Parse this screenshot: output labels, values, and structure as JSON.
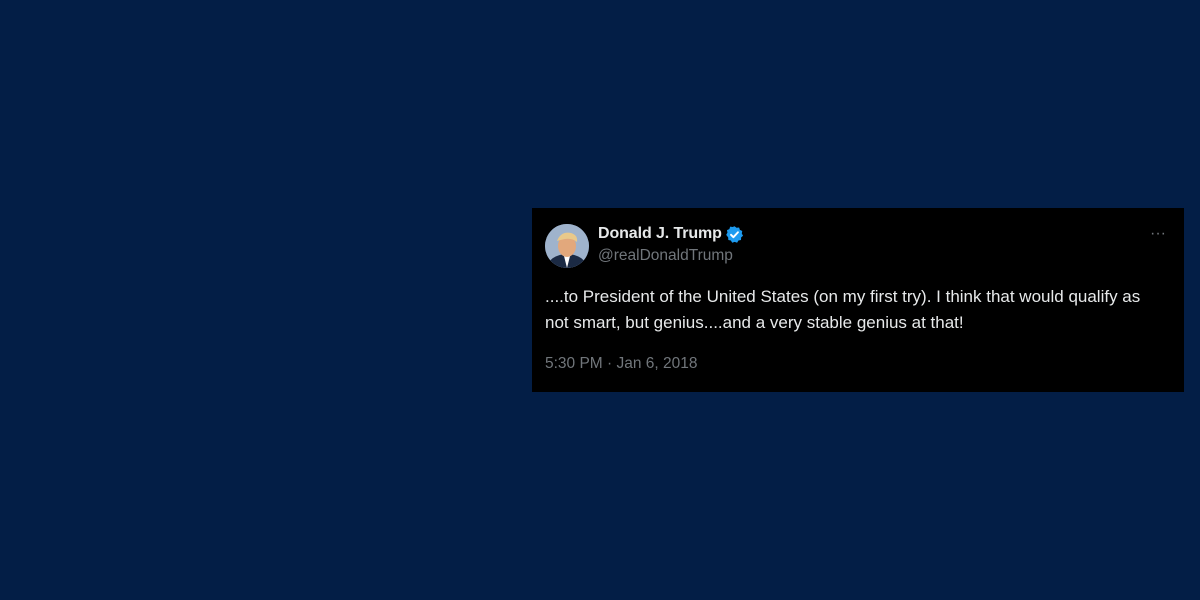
{
  "tweet": {
    "display_name": "Donald J. Trump",
    "handle": "@realDonaldTrump",
    "verified": true,
    "more_label": "···",
    "text": "....to President of the United States (on my first try). I think that would qualify as not smart, but genius....and a very stable genius at that!",
    "timestamp": "5:30 PM · Jan 6, 2018"
  },
  "colors": {
    "page_background": "#031e46",
    "card_background": "#000000",
    "primary_text": "#e7e9ea",
    "secondary_text": "#71767b",
    "verified_badge": "#1d9bf0"
  },
  "icons": {
    "avatar": "profile-photo",
    "verified": "verified-badge-icon",
    "more": "more-options-icon"
  }
}
